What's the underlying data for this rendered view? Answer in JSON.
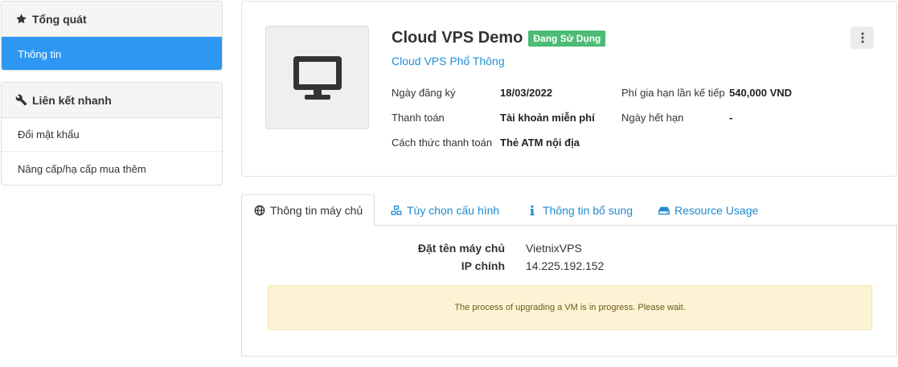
{
  "sidebar": {
    "overview": {
      "title": "Tổng quát",
      "items": [
        {
          "label": "Thông tin",
          "active": true
        }
      ]
    },
    "quick_links": {
      "title": "Liên kết nhanh",
      "items": [
        {
          "label": "Đổi mật khẩu"
        },
        {
          "label": "Nâng cấp/hạ cấp mua thêm"
        }
      ]
    }
  },
  "product": {
    "icon": "monitor-icon",
    "name": "Cloud VPS Demo",
    "status": "Đang Sử Dụng",
    "status_color": "#4cbb74",
    "group": "Cloud VPS Phổ Thông",
    "fields": {
      "registration_date_label": "Ngày đăng ký",
      "registration_date_value": "18/03/2022",
      "payment_label": "Thanh toán",
      "payment_value": "Tài khoản miễn phí",
      "payment_method_label": "Cách thức thanh toán",
      "payment_method_value": "Thẻ ATM nội địa",
      "renewal_fee_label": "Phí gia hạn lần kế tiếp",
      "renewal_fee_value": "540,000 VND",
      "expiry_label": "Ngày hết hạn",
      "expiry_value": "-"
    }
  },
  "tabs": [
    {
      "label": "Thông tin máy chủ",
      "icon": "globe-icon",
      "active": true
    },
    {
      "label": "Tùy chọn cấu hình",
      "icon": "cubes-icon",
      "active": false
    },
    {
      "label": "Thông tin bổ sung",
      "icon": "info-icon",
      "active": false
    },
    {
      "label": "Resource Usage",
      "icon": "hdd-icon",
      "active": false
    }
  ],
  "server_info": {
    "hostname_label": "Đặt tên máy chủ",
    "hostname_value": "VietnixVPS",
    "ip_label": "IP chính",
    "ip_value": "14.225.192.152"
  },
  "alert": {
    "message": "The process of upgrading a VM is in progress. Please wait."
  },
  "colors": {
    "accent": "#2d98f3",
    "link": "#1f8bd0",
    "alert_bg": "#fcf3d4"
  }
}
